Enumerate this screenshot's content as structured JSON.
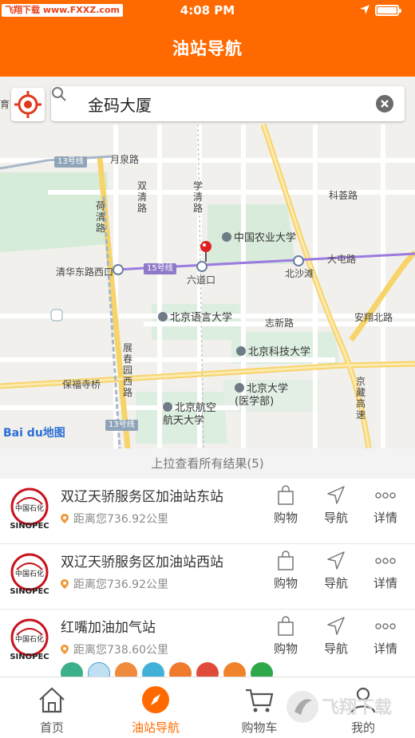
{
  "status": {
    "watermark": "飞翔下载 www.FXXZ.com",
    "time": "4:08 PM"
  },
  "header": {
    "title": "油站导航"
  },
  "search": {
    "value": "金码大厦"
  },
  "map": {
    "labels": {
      "yuechen_road": "月泉路",
      "shuangqing_road": "双清路",
      "xueqing_road": "学清路",
      "kehui_road": "科荟路",
      "heqing_road": "荷清路",
      "tsinghua_east": "清华东路西口",
      "liudaokou": "六道口",
      "beishatan": "北沙滩",
      "datun_road": "大屯路",
      "zhixin_road": "志新路",
      "anxiang_road": "安翔北路",
      "zhanchun_road": "展春园西路",
      "baofusi_bridge": "保福寺桥",
      "jingzang": "京藏高速",
      "line13a": "13号线",
      "line15": "15号线",
      "line13b": "13号线",
      "edge_left": "育"
    },
    "pois": {
      "cau": "中国农业大学",
      "blcu": "北京语言大学",
      "ustb": "北京科技大学",
      "pku_med": "北京大学\n(医学部)",
      "buaa": "北京航空\n航天大学"
    },
    "logo": "Bai du地图"
  },
  "pull_text": "上拉查看所有结果(5)",
  "results": [
    {
      "name": "双辽天骄服务区加油站东站",
      "distance": "距离您736.92公里",
      "shop": "购物",
      "nav": "导航",
      "detail": "详情"
    },
    {
      "name": "双辽天骄服务区加油站西站",
      "distance": "距离您736.92公里",
      "shop": "购物",
      "nav": "导航",
      "detail": "详情"
    },
    {
      "name": "红嘴加油加气站",
      "distance": "距离您738.60公里",
      "shop": "购物",
      "nav": "导航",
      "detail": "详情"
    }
  ],
  "tabs": {
    "home": "首页",
    "station": "油站导航",
    "cart": "购物车",
    "mine": "我的"
  },
  "watermark2": "飞翔下载",
  "colors": {
    "brand": "#ff6a00",
    "accent_line": "#9b7be0"
  }
}
